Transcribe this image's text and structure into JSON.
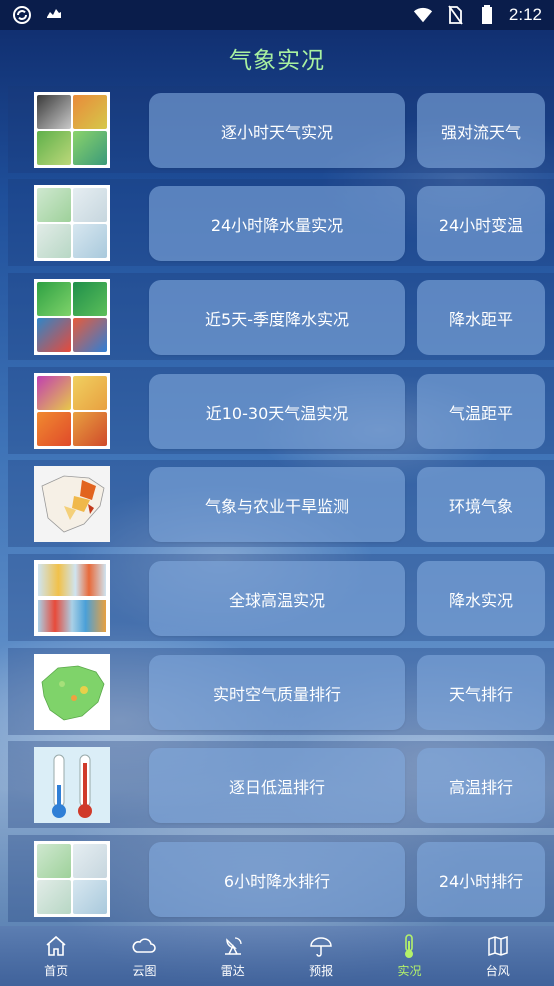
{
  "status_bar": {
    "time": "2:12",
    "left_icons": [
      "sync-icon",
      "weather-app-icon"
    ],
    "right_icons": [
      "wifi-icon",
      "no-sim-icon",
      "battery-icon"
    ]
  },
  "header": {
    "title": "气象实况"
  },
  "rows": [
    {
      "thumb": "map-grid-temperature",
      "main_label": "逐小时天气实况",
      "side_label": "强对流天气"
    },
    {
      "thumb": "map-grid-precip",
      "main_label": "24小时降水量实况",
      "side_label": "24小时变温"
    },
    {
      "thumb": "map-grid-green",
      "main_label": "近5天-季度降水实况",
      "side_label": "降水距平"
    },
    {
      "thumb": "map-grid-warm",
      "main_label": "近10-30天气温实况",
      "side_label": "气温距平"
    },
    {
      "thumb": "map-drought",
      "main_label": "气象与农业干旱监测",
      "side_label": "环境气象"
    },
    {
      "thumb": "map-global",
      "main_label": "全球高温实况",
      "side_label": "降水实况"
    },
    {
      "thumb": "map-air-quality",
      "main_label": "实时空气质量排行",
      "side_label": "天气排行"
    },
    {
      "thumb": "thermometers",
      "main_label": "逐日低温排行",
      "side_label": "高温排行"
    },
    {
      "thumb": "map-grid-precip",
      "main_label": "6小时降水排行",
      "side_label": "24小时排行"
    }
  ],
  "bottom_nav": [
    {
      "label": "首页",
      "icon": "home-icon",
      "active": false
    },
    {
      "label": "云图",
      "icon": "cloud-icon",
      "active": false
    },
    {
      "label": "雷达",
      "icon": "radar-icon",
      "active": false
    },
    {
      "label": "预报",
      "icon": "umbrella-icon",
      "active": false
    },
    {
      "label": "实况",
      "icon": "thermometer-icon",
      "active": true
    },
    {
      "label": "台风",
      "icon": "map-icon",
      "active": false
    }
  ],
  "colors": {
    "title": "#a8f1a0",
    "active_nav": "#b4f26a",
    "status_bar": "#0a1d4b",
    "button_fill": "#82aade"
  }
}
